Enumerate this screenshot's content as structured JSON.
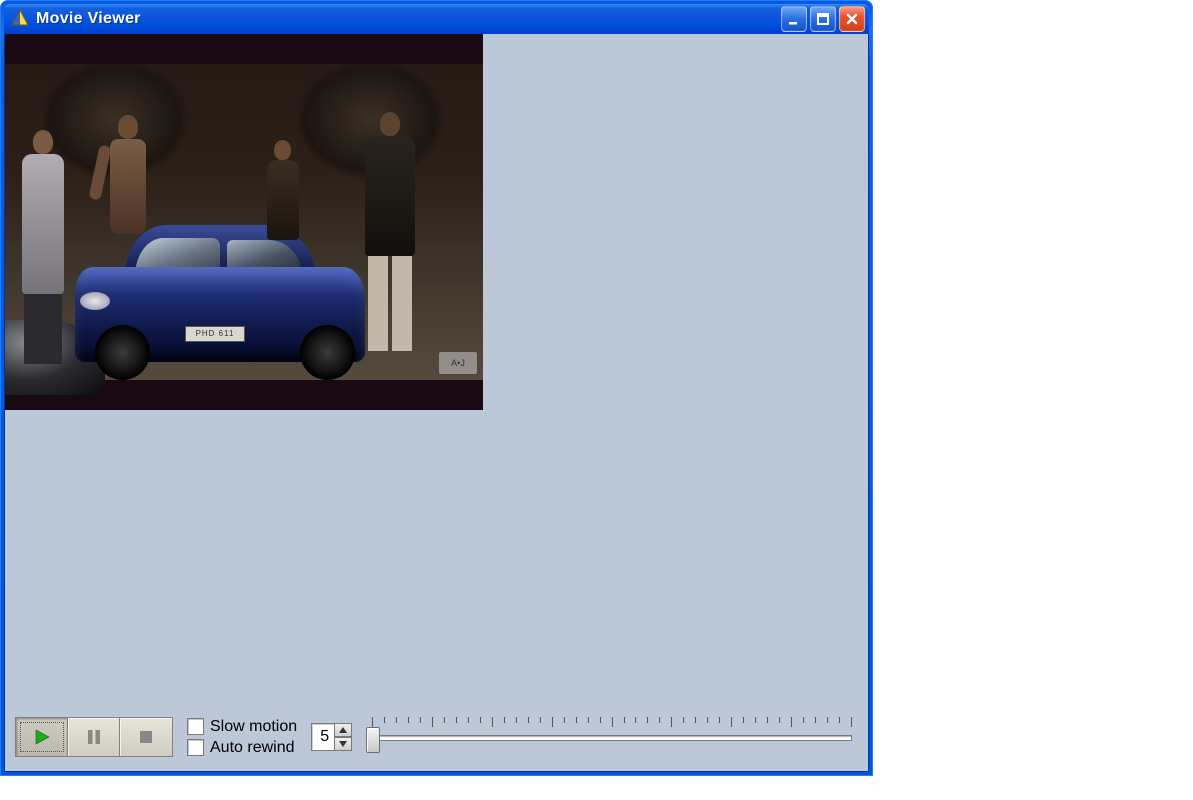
{
  "titlebar": {
    "title": "Movie Viewer"
  },
  "controls": {
    "slow_motion_label": "Slow motion",
    "auto_rewind_label": "Auto rewind",
    "slow_motion_checked": false,
    "auto_rewind_checked": false,
    "spinner_value": "5",
    "slider_position": 0
  },
  "playback": {
    "play_active": true
  },
  "video": {
    "plate_text": "PHD 611"
  }
}
